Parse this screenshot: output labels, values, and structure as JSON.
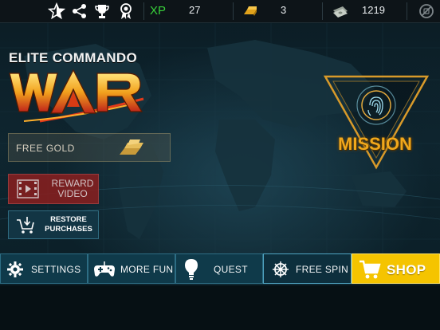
{
  "topbar": {
    "icons": [
      "star-icon",
      "share-icon",
      "trophy-icon",
      "medal-icon"
    ],
    "xp_label": "XP",
    "xp_value": "27",
    "gold_value": "3",
    "cash_value": "1219",
    "no_ads_icon": "no-ads-icon"
  },
  "logo": {
    "subtitle": "ELITE COMMANDO",
    "title": "WAR"
  },
  "left_menu": {
    "free_gold": "FREE GOLD",
    "reward_video": "REWARD VIDEO",
    "reward_line1": "REWARD",
    "reward_line2": "VIDEO",
    "restore_line1": "RESTORE",
    "restore_line2": "PURCHASES"
  },
  "mission": {
    "label": "MISSION"
  },
  "bottom_nav": {
    "settings": "SETTINGS",
    "more_fun": "MORE FUN",
    "quest": "QUEST",
    "free_spin": "FREE SPIN",
    "shop": "SHOP"
  },
  "colors": {
    "xp_green": "#38d13a",
    "mission_orange": "#f0a81c",
    "shop_yellow": "#f5c400",
    "nav_teal": "#0f3a4a"
  }
}
